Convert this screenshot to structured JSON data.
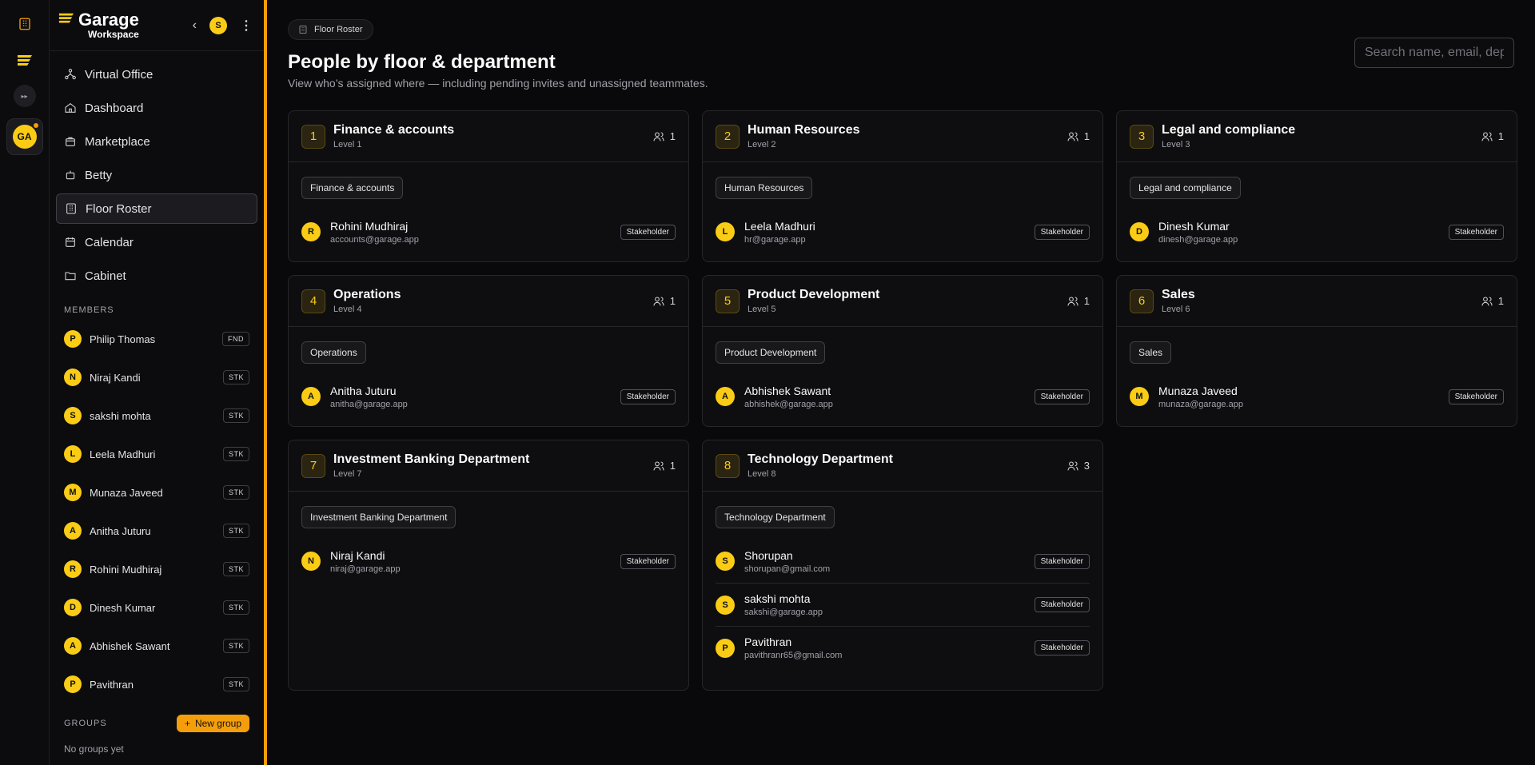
{
  "sidebar": {
    "brand": "Garage",
    "workspace": "Workspace",
    "user_initial": "S",
    "rail_ws_initials": "GA",
    "nav": [
      {
        "label": "Virtual Office",
        "icon": "network-icon"
      },
      {
        "label": "Dashboard",
        "icon": "home-icon"
      },
      {
        "label": "Marketplace",
        "icon": "bag-icon"
      },
      {
        "label": "Betty",
        "icon": "bot-icon"
      },
      {
        "label": "Floor Roster",
        "icon": "building-icon",
        "active": true
      },
      {
        "label": "Calendar",
        "icon": "calendar-icon"
      },
      {
        "label": "Cabinet",
        "icon": "folder-icon"
      }
    ],
    "members_label": "MEMBERS",
    "members": [
      {
        "initial": "P",
        "name": "Philip Thomas",
        "tag": "FND"
      },
      {
        "initial": "N",
        "name": "Niraj Kandi",
        "tag": "STK"
      },
      {
        "initial": "S",
        "name": "sakshi mohta",
        "tag": "STK"
      },
      {
        "initial": "L",
        "name": "Leela Madhuri",
        "tag": "STK"
      },
      {
        "initial": "M",
        "name": "Munaza Javeed",
        "tag": "STK"
      },
      {
        "initial": "A",
        "name": "Anitha Juturu",
        "tag": "STK"
      },
      {
        "initial": "R",
        "name": "Rohini Mudhiraj",
        "tag": "STK"
      },
      {
        "initial": "D",
        "name": "Dinesh Kumar",
        "tag": "STK"
      },
      {
        "initial": "A",
        "name": "Abhishek Sawant",
        "tag": "STK"
      },
      {
        "initial": "P",
        "name": "Pavithran",
        "tag": "STK"
      }
    ],
    "groups_label": "GROUPS",
    "new_group": "New group",
    "no_groups": "No groups yet"
  },
  "main": {
    "breadcrumb": "Floor Roster",
    "title": "People by floor & department",
    "subtitle": "View who’s assigned where — including pending invites and unassigned teammates.",
    "search_placeholder": "Search name, email, department",
    "floors": [
      {
        "num": "1",
        "name": "Finance & accounts",
        "level": "Level 1",
        "count": "1",
        "dept": "Finance & accounts",
        "people": [
          {
            "initial": "R",
            "name": "Rohini Mudhiraj",
            "email": "accounts@garage.app",
            "role": "Stakeholder"
          }
        ]
      },
      {
        "num": "2",
        "name": "Human Resources",
        "level": "Level 2",
        "count": "1",
        "dept": "Human Resources",
        "people": [
          {
            "initial": "L",
            "name": "Leela Madhuri",
            "email": "hr@garage.app",
            "role": "Stakeholder"
          }
        ]
      },
      {
        "num": "3",
        "name": "Legal and compliance",
        "level": "Level 3",
        "count": "1",
        "dept": "Legal and compliance",
        "people": [
          {
            "initial": "D",
            "name": "Dinesh Kumar",
            "email": "dinesh@garage.app",
            "role": "Stakeholder"
          }
        ]
      },
      {
        "num": "4",
        "name": "Operations",
        "level": "Level 4",
        "count": "1",
        "dept": "Operations",
        "people": [
          {
            "initial": "A",
            "name": "Anitha Juturu",
            "email": "anitha@garage.app",
            "role": "Stakeholder"
          }
        ]
      },
      {
        "num": "5",
        "name": "Product Development",
        "level": "Level 5",
        "count": "1",
        "dept": "Product Development",
        "people": [
          {
            "initial": "A",
            "name": "Abhishek Sawant",
            "email": "abhishek@garage.app",
            "role": "Stakeholder"
          }
        ]
      },
      {
        "num": "6",
        "name": "Sales",
        "level": "Level 6",
        "count": "1",
        "dept": "Sales",
        "people": [
          {
            "initial": "M",
            "name": "Munaza Javeed",
            "email": "munaza@garage.app",
            "role": "Stakeholder"
          }
        ]
      },
      {
        "num": "7",
        "name": "Investment Banking Department",
        "level": "Level 7",
        "count": "1",
        "dept": "Investment Banking Department",
        "people": [
          {
            "initial": "N",
            "name": "Niraj Kandi",
            "email": "niraj@garage.app",
            "role": "Stakeholder"
          }
        ]
      },
      {
        "num": "8",
        "name": "Technology Department",
        "level": "Level 8",
        "count": "3",
        "dept": "Technology Department",
        "people": [
          {
            "initial": "S",
            "name": "Shorupan",
            "email": "shorupan@gmail.com",
            "role": "Stakeholder"
          },
          {
            "initial": "S",
            "name": "sakshi mohta",
            "email": "sakshi@garage.app",
            "role": "Stakeholder"
          },
          {
            "initial": "P",
            "name": "Pavithran",
            "email": "pavithranr65@gmail.com",
            "role": "Stakeholder"
          }
        ]
      }
    ]
  },
  "colors": {
    "accent": "#f59e0b",
    "avatar": "#facc15",
    "background": "#09090b"
  }
}
